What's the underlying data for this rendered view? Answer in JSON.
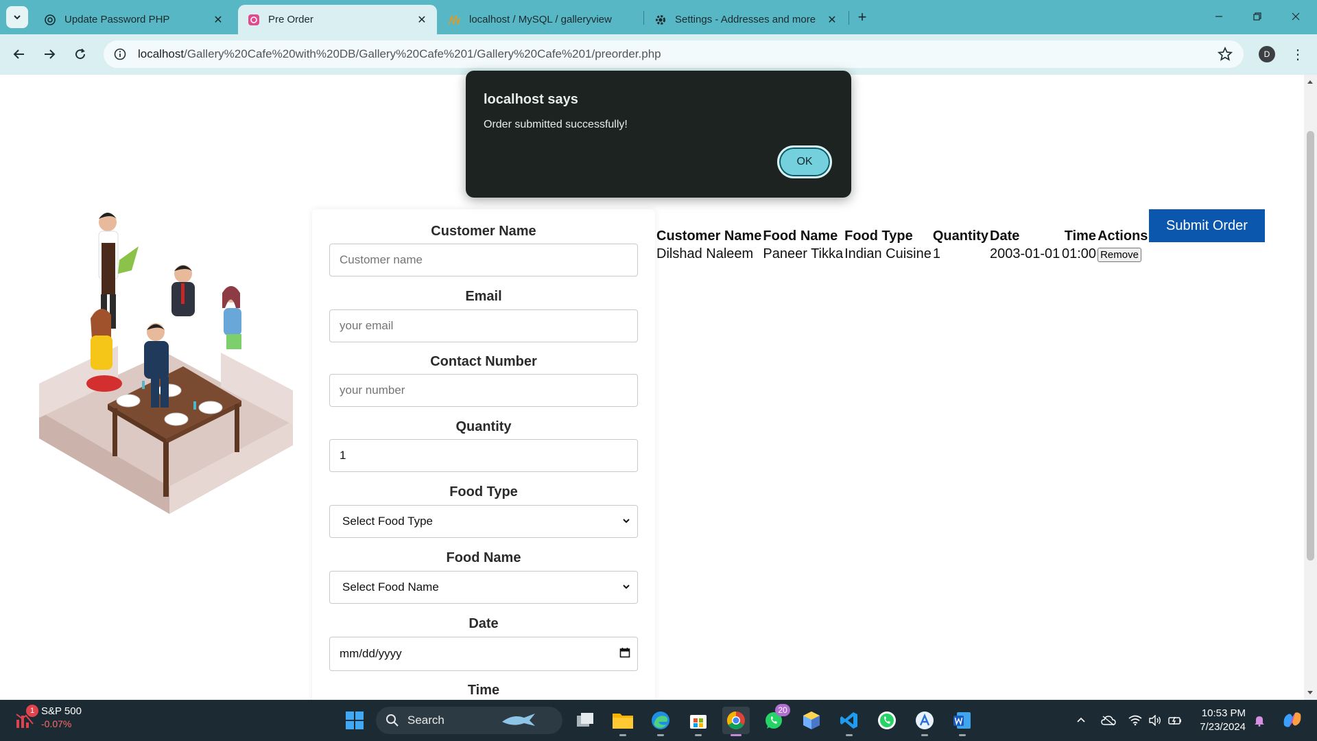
{
  "browser": {
    "tabs": [
      {
        "title": "Update Password PHP",
        "favicon": "openai-icon",
        "active": false
      },
      {
        "title": "Pre Order",
        "favicon": "site-icon",
        "active": true
      },
      {
        "title": "localhost / MySQL / galleryview",
        "favicon": "phpmyadmin-icon",
        "active": false
      },
      {
        "title": "Settings - Addresses and more",
        "favicon": "gear-icon",
        "active": false
      }
    ],
    "url_host": "localhost",
    "url_path": "/Gallery%20Cafe%20with%20DB/Gallery%20Cafe%201/Gallery%20Cafe%201/preorder.php",
    "profile_initial": "D"
  },
  "alert": {
    "title": "localhost says",
    "message": "Order submitted successfully!",
    "ok_label": "OK"
  },
  "form": {
    "customer_name": {
      "label": "Customer Name",
      "placeholder": "Customer name",
      "value": ""
    },
    "email": {
      "label": "Email",
      "placeholder": "your email",
      "value": ""
    },
    "contact": {
      "label": "Contact Number",
      "placeholder": "your number",
      "value": ""
    },
    "quantity": {
      "label": "Quantity",
      "value": "1"
    },
    "food_type": {
      "label": "Food Type",
      "selected": "Select Food Type"
    },
    "food_name": {
      "label": "Food Name",
      "selected": "Select Food Name"
    },
    "date": {
      "label": "Date",
      "value": "mm/dd/yyyy"
    },
    "time": {
      "label": "Time"
    }
  },
  "orders": {
    "headers": [
      "Customer Name",
      "Food Name",
      "Food Type",
      "Quantity",
      "Date",
      "Time",
      "Actions"
    ],
    "rows": [
      [
        "Dilshad Naleem",
        "Paneer Tikka",
        "Indian Cuisine",
        "1",
        "2003-01-01",
        "01:00",
        "Remove"
      ]
    ]
  },
  "submit_label": "Submit Order",
  "taskbar": {
    "widget_name": "S&P 500",
    "widget_value": "-0.07%",
    "widget_badge": "1",
    "search_label": "Search",
    "whatsapp_badge": "20",
    "time": "10:53 PM",
    "date": "7/23/2024"
  },
  "colors": {
    "tabstrip": "#58b7c5",
    "toolbar": "#d9eff2",
    "submit": "#0a57ad",
    "dialog": "#1c2321",
    "ok_button": "#74d0dc",
    "taskbar": "#1c2b33"
  }
}
